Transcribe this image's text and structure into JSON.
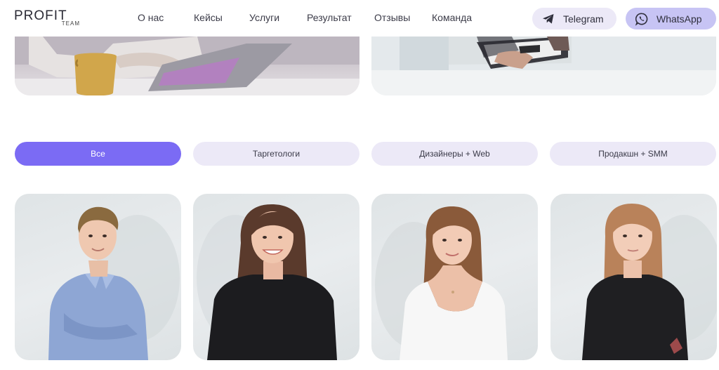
{
  "header": {
    "logo_main": "PROFIT",
    "logo_sub": "TEAM",
    "nav": [
      {
        "label": "О нас"
      },
      {
        "label": "Кейсы"
      },
      {
        "label": "Услуги"
      },
      {
        "label": "Результат"
      },
      {
        "label": "Отзывы"
      },
      {
        "label": "Команда"
      }
    ],
    "telegram_label": "Telegram",
    "whatsapp_label": "WhatsApp"
  },
  "filters": [
    {
      "label": "Все",
      "active": true
    },
    {
      "label": "Таргетологи",
      "active": false
    },
    {
      "label": "Дизайнеры + Web",
      "active": false
    },
    {
      "label": "Продакшн + SMM",
      "active": false
    }
  ],
  "colors": {
    "accent": "#7b6bf4",
    "accent_light": "#c7c4f4",
    "pill_bg": "#ece9f7"
  }
}
